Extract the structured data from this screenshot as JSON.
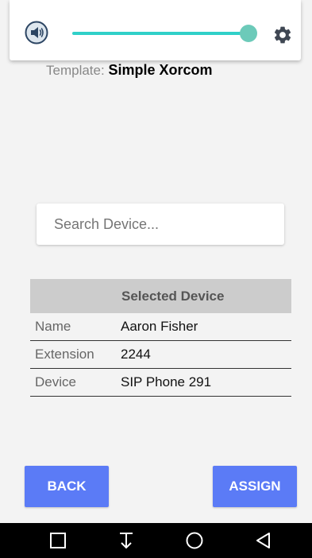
{
  "volume_control": {
    "speaker_icon": "speaker-volume-icon",
    "settings_icon": "gear-icon",
    "level": 1.0,
    "accent_color": "#30d0c8"
  },
  "template": {
    "label": "Template:",
    "name": "Simple Xorcom"
  },
  "search": {
    "placeholder": "Search Device...",
    "value": ""
  },
  "selected_device": {
    "header": "Selected Device",
    "rows": [
      {
        "label": "Name",
        "value": "Aaron Fisher"
      },
      {
        "label": "Extension",
        "value": "2244"
      },
      {
        "label": "Device",
        "value": "SIP Phone 291"
      }
    ]
  },
  "buttons": {
    "back": "BACK",
    "assign": "ASSIGN",
    "color": "#5b7bf6"
  },
  "nav_bar": {
    "icons": [
      "square-recents-icon",
      "download-arrow-icon",
      "circle-home-icon",
      "triangle-back-icon"
    ]
  }
}
